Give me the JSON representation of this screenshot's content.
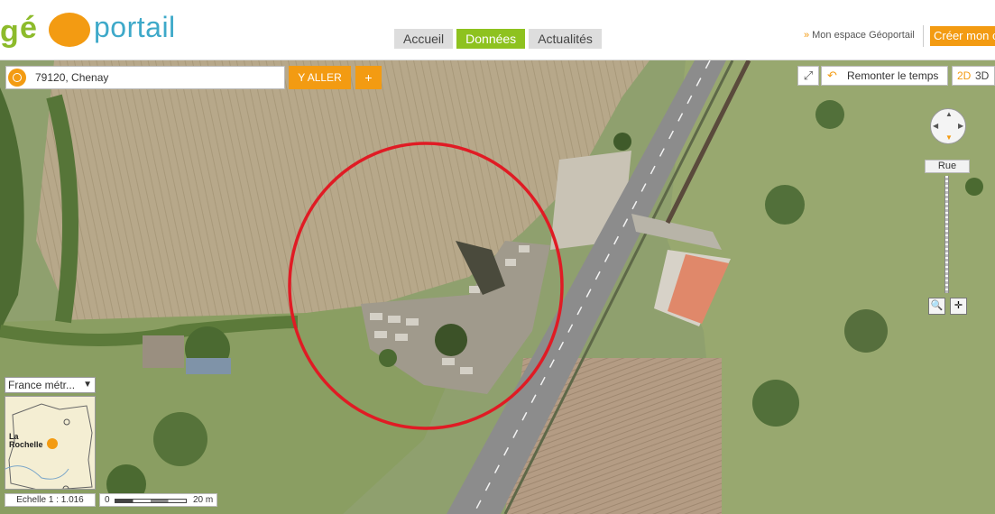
{
  "header": {
    "logo": {
      "prefix": "gé",
      "suffix": "portail"
    },
    "nav": [
      {
        "label": "Accueil",
        "active": false
      },
      {
        "label": "Données",
        "active": true
      },
      {
        "label": "Actualités",
        "active": false
      }
    ],
    "account_link": "Mon espace Géoportail",
    "create_button": "Créer mon c"
  },
  "search": {
    "value": "79120, Chenay",
    "go_label": "Y ALLER",
    "add_label": "+"
  },
  "map_controls": {
    "remonter_label": "Remonter le temps",
    "mode_2d": "2D",
    "mode_3d": "3D",
    "zoom_level_label": "Rue"
  },
  "minimap": {
    "region_select": "France métr...",
    "city_label_line1": "La",
    "city_label_line2": "Rochelle"
  },
  "scale": {
    "label": "Echelle 1 :  1.016",
    "start": "0",
    "end": "20 m"
  },
  "colors": {
    "accent": "#f39b12",
    "nav_active": "#8ec21f",
    "annotation_circle": "#e01b24"
  }
}
